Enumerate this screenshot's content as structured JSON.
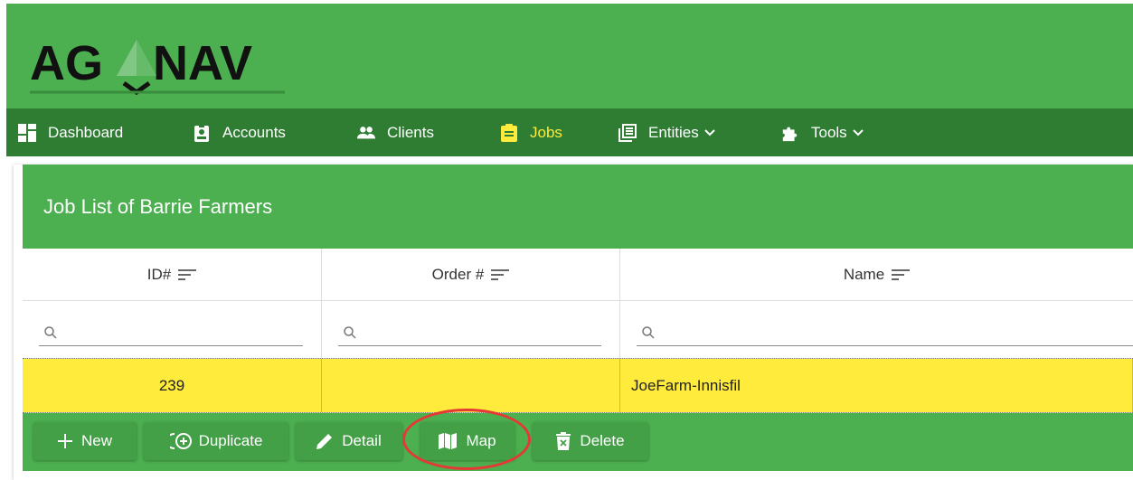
{
  "app": {
    "logo_text": "AGNAV",
    "brand_color": "#4caf50",
    "nav_color": "#2e7d32",
    "active_color": "#ffeb3b",
    "annotation_color": "#e53935"
  },
  "nav": {
    "items": [
      {
        "label": "Dashboard",
        "icon": "dashboard-icon"
      },
      {
        "label": "Accounts",
        "icon": "account-badge-icon"
      },
      {
        "label": "Clients",
        "icon": "people-icon"
      },
      {
        "label": "Jobs",
        "icon": "clipboard-icon",
        "active": true
      },
      {
        "label": "Entities",
        "icon": "list-icon",
        "dropdown": true
      },
      {
        "label": "Tools",
        "icon": "puzzle-icon",
        "dropdown": true
      }
    ]
  },
  "panel": {
    "title": "Job List of Barrie Farmers"
  },
  "table": {
    "columns": [
      {
        "label": "ID#",
        "icon": "sort-icon"
      },
      {
        "label": "Order #",
        "icon": "sort-icon"
      },
      {
        "label": "Name",
        "icon": "sort-icon"
      }
    ],
    "filters": [
      {
        "value": "",
        "placeholder": ""
      },
      {
        "value": "",
        "placeholder": ""
      },
      {
        "value": "",
        "placeholder": ""
      }
    ],
    "rows": [
      {
        "id": "239",
        "order": "",
        "name": "JoeFarm-Innisfil",
        "selected": true
      }
    ]
  },
  "toolbar": {
    "buttons": [
      {
        "label": "New",
        "icon": "plus-icon"
      },
      {
        "label": "Duplicate",
        "icon": "duplicate-icon"
      },
      {
        "label": "Detail",
        "icon": "pencil-icon"
      },
      {
        "label": "Map",
        "icon": "map-icon",
        "highlighted": true
      },
      {
        "label": "Delete",
        "icon": "trash-icon"
      }
    ]
  }
}
